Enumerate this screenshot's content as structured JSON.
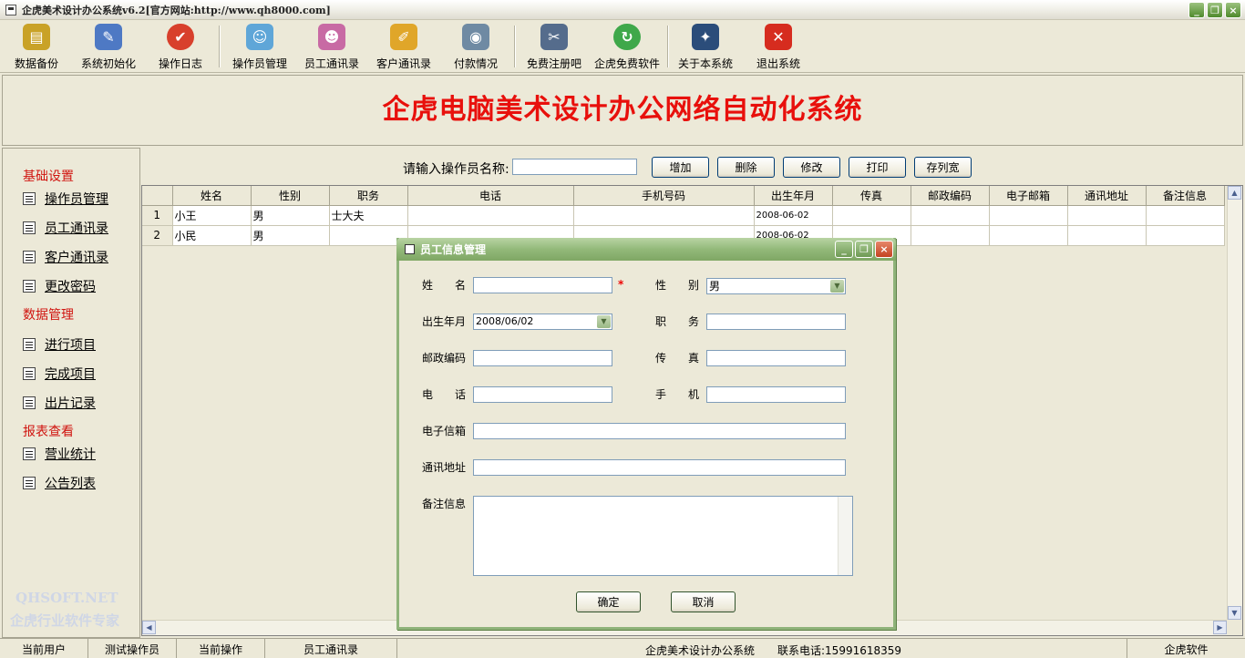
{
  "window": {
    "title": "企虎美术设计办公系统v6.2[官方网站:http://www.qh8000.com]",
    "btn_min": "_",
    "btn_restore": "❐",
    "btn_close": "×"
  },
  "toolbar": {
    "items": [
      {
        "label": "数据备份",
        "icon": "database-icon",
        "glyph": "▤",
        "color": "#c9a227"
      },
      {
        "label": "系统初始化",
        "icon": "init-icon",
        "glyph": "✎",
        "color": "#4e79c4"
      },
      {
        "label": "操作日志",
        "icon": "log-icon",
        "glyph": "✔",
        "color": "#d8402c"
      },
      {
        "label": "操作员管理",
        "icon": "operator-icon",
        "glyph": "☺",
        "color": "#5fa6d8"
      },
      {
        "label": "员工通讯录",
        "icon": "employee-book-icon",
        "glyph": "☻",
        "color": "#c86aa4"
      },
      {
        "label": "客户通讯录",
        "icon": "customer-book-icon",
        "glyph": "✐",
        "color": "#e0a629"
      },
      {
        "label": "付款情况",
        "icon": "payment-icon",
        "glyph": "◉",
        "color": "#6f8aa3"
      },
      {
        "label": "免费注册吧",
        "icon": "register-icon",
        "glyph": "✂",
        "color": "#556c8c"
      },
      {
        "label": "企虎免费软件",
        "icon": "free-software-icon",
        "glyph": "↻",
        "color": "#3fa84a"
      },
      {
        "label": "关于本系统",
        "icon": "about-icon",
        "glyph": "✦",
        "color": "#2b4d7a"
      },
      {
        "label": "退出系统",
        "icon": "exit-icon",
        "glyph": "✕",
        "color": "#d62c1f"
      }
    ]
  },
  "banner": {
    "title": "企虎电脑美术设计办公网络自动化系统"
  },
  "sidebar": {
    "groups": [
      {
        "title": "基础设置",
        "items": [
          "操作员管理",
          "员工通讯录",
          "客户通讯录",
          "更改密码"
        ]
      },
      {
        "title": "数据管理",
        "items": [
          "进行项目",
          "完成项目",
          "出片记录"
        ]
      },
      {
        "title": "报表查看",
        "items": [
          "营业统计",
          "公告列表"
        ]
      }
    ],
    "brand_line1": "QHSOFT.NET",
    "brand_line2": "企虎行业软件专家"
  },
  "search": {
    "label": "请输入操作员名称:",
    "value": "",
    "buttons": {
      "add": "增加",
      "delete": "删除",
      "edit": "修改",
      "print": "打印",
      "save_width": "存列宽"
    }
  },
  "grid": {
    "columns": [
      "姓名",
      "性别",
      "职务",
      "电话",
      "手机号码",
      "出生年月",
      "传真",
      "邮政编码",
      "电子邮箱",
      "通讯地址",
      "备注信息"
    ],
    "rows": [
      {
        "no": "1",
        "cells": [
          "小王",
          "男",
          "士大夫",
          "",
          "",
          "2008-06-02",
          "",
          "",
          "",
          "",
          ""
        ]
      },
      {
        "no": "2",
        "cells": [
          "小民",
          "男",
          "",
          "",
          "",
          "2008-06-02",
          "",
          "",
          "",
          "",
          ""
        ]
      }
    ]
  },
  "dialog": {
    "title": "员工信息管理",
    "fields": {
      "name_label": "姓　　名",
      "name_value": "",
      "required_mark": "*",
      "gender_label": "性　　别",
      "gender_value": "男",
      "birth_label": "出生年月",
      "birth_value": "2008/06/02",
      "title_label": "职　　务",
      "title_value": "",
      "zip_label": "邮政编码",
      "zip_value": "",
      "fax_label": "传　　真",
      "fax_value": "",
      "phone_label": "电　　话",
      "phone_value": "",
      "mobile_label": "手　　机",
      "mobile_value": "",
      "email_label": "电子信箱",
      "email_value": "",
      "address_label": "通讯地址",
      "address_value": "",
      "notes_label": "备注信息",
      "notes_value": ""
    },
    "ok": "确定",
    "cancel": "取消"
  },
  "statusbar": {
    "current_user_label": "当前用户",
    "current_user": "测试操作员",
    "current_op_label": "当前操作",
    "current_op": "员工通讯录",
    "system_name": "企虎美术设计办公系统",
    "contact": "联系电话:15991618359",
    "vendor": "企虎软件"
  }
}
